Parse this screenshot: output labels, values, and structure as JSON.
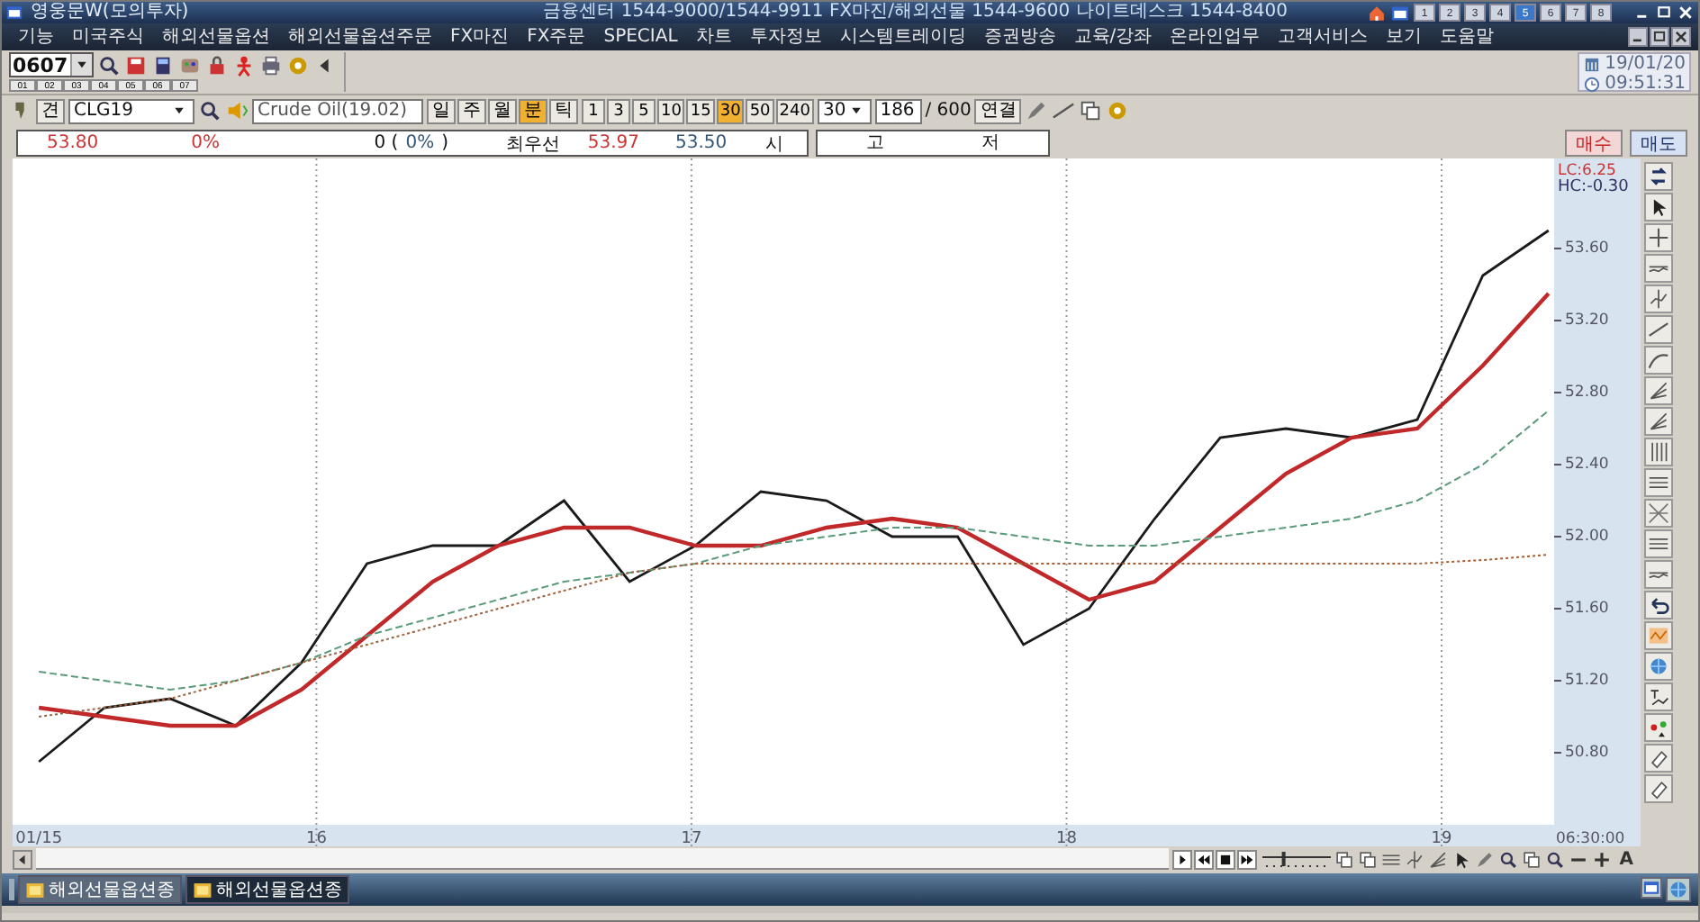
{
  "window": {
    "title": "영웅문W(모의투자)",
    "center_info": "금융센터 1544-9000/1544-9911  FX마진/해외선물 1544-9600 나이트데스크 1544-8400",
    "screen_buttons": [
      {
        "label": "1",
        "selected": false
      },
      {
        "label": "2",
        "selected": false
      },
      {
        "label": "3",
        "selected": false
      },
      {
        "label": "4",
        "selected": false
      },
      {
        "label": "5",
        "selected": true
      },
      {
        "label": "6",
        "selected": false
      },
      {
        "label": "7",
        "selected": false
      },
      {
        "label": "8",
        "selected": false
      }
    ]
  },
  "menu": [
    "기능",
    "미국주식",
    "해외선물옵션",
    "해외선물옵션주문",
    "FX마진",
    "FX주문",
    "SPECIAL",
    "차트",
    "투자정보",
    "시스템트레이딩",
    "증권방송",
    "교육/강좌",
    "온라인업무",
    "고객서비스",
    "보기",
    "도움말"
  ],
  "toolbar": {
    "screen_number": "0607",
    "tabs": [
      "01",
      "02",
      "03",
      "04",
      "05",
      "06",
      "07"
    ],
    "date": "19/01/20",
    "time": "09:51:31"
  },
  "chart_toolbar": {
    "mode_label": "견",
    "symbol": "CLG19",
    "name": "Crude Oil(19.02)",
    "periods": [
      {
        "label": "일",
        "selected": false
      },
      {
        "label": "주",
        "selected": false
      },
      {
        "label": "월",
        "selected": false
      },
      {
        "label": "분",
        "selected": true
      },
      {
        "label": "틱",
        "selected": false
      }
    ],
    "intervals": [
      {
        "label": "1",
        "selected": false
      },
      {
        "label": "3",
        "selected": false
      },
      {
        "label": "5",
        "selected": false
      },
      {
        "label": "10",
        "selected": false
      },
      {
        "label": "15",
        "selected": false
      },
      {
        "label": "30",
        "selected": true
      },
      {
        "label": "50",
        "selected": false
      },
      {
        "label": "240",
        "selected": false
      }
    ],
    "interval_value": "30",
    "count": "186",
    "max_count": "/ 600",
    "link_button": "연결"
  },
  "quote": {
    "price": "53.80",
    "change_pct": "0%",
    "volume": "0 (",
    "volume_pct": "0%",
    "volume_close": ")",
    "best_label": "최우선",
    "ask": "53.97",
    "bid": "53.50",
    "open_label": "시",
    "high_label": "고",
    "low_label": "저",
    "buy_button": "매수",
    "sell_button": "매도"
  },
  "chart": {
    "lc": "LC:6.25",
    "hc": "HC:-0.30",
    "time_label": "06:30:00",
    "text_button": "A",
    "zoom": {
      "level": 0.3
    },
    "chart_data": {
      "type": "line",
      "x": [
        15.26,
        15.435,
        15.61,
        15.785,
        15.96,
        16.135,
        16.31,
        16.485,
        16.66,
        16.835,
        17.01,
        17.185,
        17.36,
        17.535,
        17.71,
        17.885,
        18.06,
        18.235,
        18.41,
        18.585,
        18.76,
        18.935,
        19.11,
        19.285
      ],
      "series": [
        {
          "color": "#1a1a1a",
          "line_style": "solid",
          "values": [
            50.75,
            51.05,
            51.1,
            50.95,
            51.3,
            51.85,
            51.95,
            51.95,
            52.2,
            51.75,
            51.95,
            52.25,
            52.2,
            52.0,
            52.0,
            51.4,
            51.6,
            52.1,
            52.55,
            52.6,
            52.55,
            52.65,
            53.45,
            53.7
          ]
        },
        {
          "color": "#c0282a",
          "line_style": "solid",
          "values": [
            51.05,
            51.0,
            50.95,
            50.95,
            51.15,
            51.45,
            51.75,
            51.95,
            52.05,
            52.05,
            51.95,
            51.95,
            52.05,
            52.1,
            52.05,
            51.85,
            51.65,
            51.75,
            52.05,
            52.35,
            52.55,
            52.6,
            52.95,
            53.35
          ]
        },
        {
          "color": "#5a9a7a",
          "line_style": "dashed",
          "values": [
            51.25,
            51.2,
            51.15,
            51.2,
            51.3,
            51.45,
            51.55,
            51.65,
            51.75,
            51.8,
            51.85,
            51.95,
            52.0,
            52.05,
            52.05,
            52.0,
            51.95,
            51.95,
            52.0,
            52.05,
            52.1,
            52.2,
            52.4,
            52.7
          ]
        },
        {
          "color": "#a0603a",
          "line_style": "dotted",
          "values": [
            51.0,
            51.05,
            51.1,
            51.2,
            51.3,
            51.4,
            51.5,
            51.6,
            51.7,
            51.8,
            51.85,
            51.85,
            51.85,
            51.85,
            51.85,
            51.85,
            51.85,
            51.85,
            51.85,
            51.85,
            51.85,
            51.85,
            51.87,
            51.9
          ]
        }
      ],
      "grid": "x",
      "xlim": [
        15.19,
        19.3
      ],
      "ylim": [
        50.4,
        54.1
      ],
      "xticks": [
        {
          "value": 15.26,
          "label": "01/15"
        },
        16,
        17,
        18,
        19
      ],
      "yticks": [
        {
          "value": 50.8,
          "label": "50.80"
        },
        {
          "value": 51.2,
          "label": "51.20"
        },
        {
          "value": 51.6,
          "label": "51.60"
        },
        {
          "value": 52.0,
          "label": "52.00"
        },
        {
          "value": 52.4,
          "label": "52.40"
        },
        {
          "value": 52.8,
          "label": "52.80"
        },
        {
          "value": 53.2,
          "label": "53.20"
        },
        {
          "value": 53.6,
          "label": "53.60"
        }
      ]
    }
  },
  "taskbar": {
    "tabs": [
      {
        "label": "해외선물옵션종",
        "selected": true
      },
      {
        "label": "해외선물옵션종",
        "selected": false
      }
    ]
  }
}
